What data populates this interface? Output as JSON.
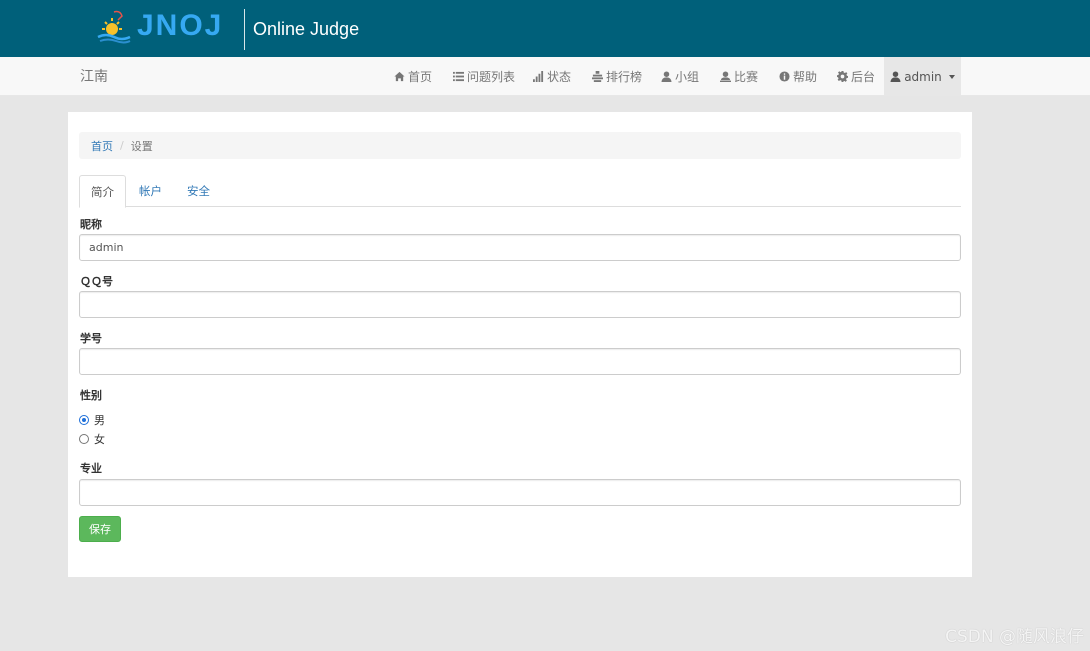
{
  "banner": {
    "logo_text": "JNOJ",
    "title": "Online Judge"
  },
  "navbar": {
    "brand": "江南",
    "items": [
      {
        "label": "首页",
        "icon": "home-icon"
      },
      {
        "label": "问题列表",
        "icon": "list-icon"
      },
      {
        "label": "状态",
        "icon": "signal-icon"
      },
      {
        "label": "排行榜",
        "icon": "podium-icon"
      },
      {
        "label": "小组",
        "icon": "user-icon"
      },
      {
        "label": "比赛",
        "icon": "trophy-icon"
      },
      {
        "label": "帮助",
        "icon": "info-icon"
      },
      {
        "label": "后台",
        "icon": "gear-icon"
      }
    ],
    "user_menu": {
      "label": "admin",
      "icon": "user-icon"
    }
  },
  "breadcrumb": {
    "home": "首页",
    "separator": "/",
    "current": "设置"
  },
  "tabs": [
    {
      "label": "简介",
      "active": true
    },
    {
      "label": "帐户",
      "active": false
    },
    {
      "label": "安全",
      "active": false
    }
  ],
  "form": {
    "nickname": {
      "label": "昵称",
      "value": "admin"
    },
    "qq": {
      "label": "ＱＱ号",
      "value": ""
    },
    "student_id": {
      "label": "学号",
      "value": ""
    },
    "gender": {
      "label": "性别",
      "options": [
        {
          "label": "男",
          "checked": true
        },
        {
          "label": "女",
          "checked": false
        }
      ]
    },
    "major": {
      "label": "专业",
      "value": ""
    },
    "save_label": "保存"
  },
  "watermark": "CSDN @随风浪仔",
  "colors": {
    "banner_bg": "#00607a",
    "logo": "#36a9f2",
    "link": "#337ab7",
    "success": "#5cb85c",
    "page_bg": "#e6e6e6"
  }
}
